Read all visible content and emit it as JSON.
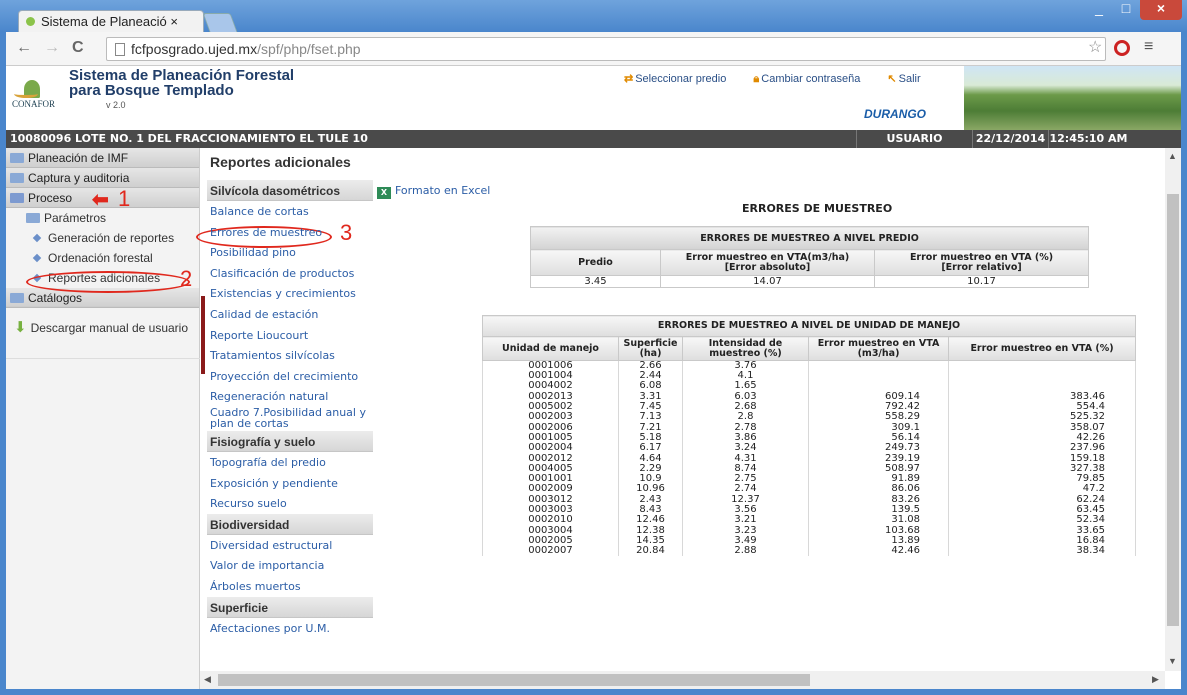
{
  "browser": {
    "tab_title": "Sistema de Planeació ×",
    "tab_close": "",
    "url_host": "fcfposgrado.ujed.mx",
    "url_path": "/spf/php/fset.php",
    "minimize": "_",
    "maximize": "□",
    "close": "×"
  },
  "header": {
    "title_line1": "Sistema de Planeación Forestal",
    "title_line2": "para Bosque Templado",
    "logo_text": "CONAFOR",
    "version": "v 2.0",
    "links": [
      "Seleccionar predio",
      "Cambiar contraseña",
      "Salir"
    ],
    "state": "DURANGO"
  },
  "infobar": {
    "lote": "10080096 LOTE NO. 1 DEL FRACCIONAMIENTO EL TULE 10",
    "user": "USUARIO",
    "date": "22/12/2014",
    "time": "12:45:10 AM"
  },
  "sidebar": {
    "groups": [
      "Planeación de IMF",
      "Captura y auditoria",
      "Proceso"
    ],
    "items": [
      "Parámetros",
      "Generación de reportes",
      "Ordenación forestal",
      "Reportes adicionales"
    ],
    "catalogos": "Catálogos",
    "download": "Descargar manual de usuario"
  },
  "annotations": {
    "n1": "1",
    "n2": "2",
    "n3": "3",
    "arrow": "⬅"
  },
  "midnav": {
    "title": "Reportes adicionales",
    "sections": [
      {
        "label": "Silvícola dasométricos",
        "items": [
          "Balance de cortas",
          "Errores de muestreo",
          "Posibilidad pino",
          "Clasificación de productos",
          "Existencias y crecimientos",
          "Calidad de estación",
          "Reporte Lioucourt",
          "Tratamientos silvícolas",
          "Proyección del crecimiento",
          "Regeneración natural",
          "Cuadro 7.Posibilidad anual y plan de cortas"
        ]
      },
      {
        "label": "Fisiografía y suelo",
        "items": [
          "Topografía del predio",
          "Exposición y pendiente",
          "Recurso suelo"
        ]
      },
      {
        "label": "Biodiversidad",
        "items": [
          "Diversidad estructural",
          "Valor de importancia",
          "Árboles muertos"
        ]
      },
      {
        "label": "Superficie",
        "items": [
          "Afectaciones por U.M."
        ]
      }
    ]
  },
  "content": {
    "excel": "Formato en Excel",
    "title": "ERRORES DE MUESTREO",
    "predio_table": {
      "caption": "ERRORES DE MUESTREO A NIVEL PREDIO",
      "headers": [
        "Predio",
        "Error muestreo en VTA(m3/ha)",
        "[Error absoluto]",
        "Error muestreo en VTA (%)",
        "[Error relativo]"
      ],
      "row": [
        "3.45",
        "14.07",
        "10.17"
      ]
    },
    "um_table": {
      "caption": "ERRORES DE MUESTREO A NIVEL DE UNIDAD DE MANEJO",
      "headers": [
        "Unidad de manejo",
        "Superficie (ha)",
        "Intensidad de muestreo (%)",
        "Error muestreo en VTA (m3/ha)",
        "Error muestreo en VTA (%)"
      ],
      "rows": [
        [
          "0001006",
          "2.66",
          "3.76",
          "",
          ""
        ],
        [
          "0001004",
          "2.44",
          "4.1",
          "",
          ""
        ],
        [
          "0004002",
          "6.08",
          "1.65",
          "",
          ""
        ],
        [
          "0002013",
          "3.31",
          "6.03",
          "609.14",
          "383.46"
        ],
        [
          "0005002",
          "7.45",
          "2.68",
          "792.42",
          "554.4"
        ],
        [
          "0002003",
          "7.13",
          "2.8",
          "558.29",
          "525.32"
        ],
        [
          "0002006",
          "7.21",
          "2.78",
          "309.1",
          "358.07"
        ],
        [
          "0001005",
          "5.18",
          "3.86",
          "56.14",
          "42.26"
        ],
        [
          "0002004",
          "6.17",
          "3.24",
          "249.73",
          "237.96"
        ],
        [
          "0002012",
          "4.64",
          "4.31",
          "239.19",
          "159.18"
        ],
        [
          "0004005",
          "2.29",
          "8.74",
          "508.97",
          "327.38"
        ],
        [
          "0001001",
          "10.9",
          "2.75",
          "91.89",
          "79.85"
        ],
        [
          "0002009",
          "10.96",
          "2.74",
          "86.06",
          "47.2"
        ],
        [
          "0003012",
          "2.43",
          "12.37",
          "83.26",
          "62.24"
        ],
        [
          "0003003",
          "8.43",
          "3.56",
          "139.5",
          "63.45"
        ],
        [
          "0002010",
          "12.46",
          "3.21",
          "31.08",
          "52.34"
        ],
        [
          "0003004",
          "12.38",
          "3.23",
          "103.68",
          "33.65"
        ],
        [
          "0002005",
          "14.35",
          "3.49",
          "13.89",
          "16.84"
        ],
        [
          "0002007",
          "20.84",
          "2.88",
          "42.46",
          "38.34"
        ]
      ]
    }
  }
}
